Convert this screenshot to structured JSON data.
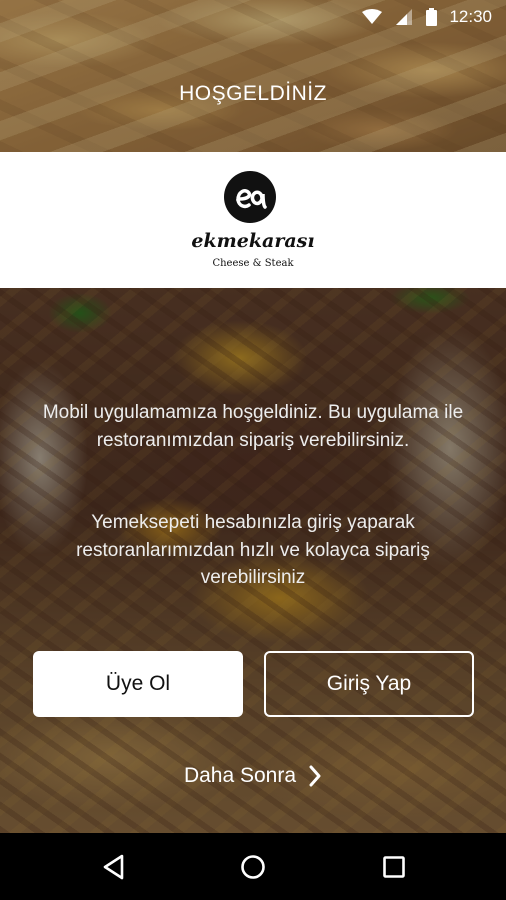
{
  "status_bar": {
    "time": "12:30",
    "icons": [
      "wifi-icon",
      "signal-icon",
      "battery-icon"
    ]
  },
  "header": {
    "title": "HOŞGELDİNİZ"
  },
  "brand": {
    "logo_icon": "ekmekarasi-logo-icon",
    "name": "ekmekarası",
    "tagline": "Cheese & Steak"
  },
  "message": {
    "paragraph_1": "Mobil uygulamamıza hoşgeldiniz. Bu uygulama ile restoranımızdan sipariş verebilirsiniz.",
    "paragraph_2": "Yemeksepeti hesabınızla giriş yaparak restoranlarımızdan hızlı ve kolayca sipariş verebilirsiniz"
  },
  "actions": {
    "register_label": "Üye Ol",
    "login_label": "Giriş Yap",
    "later_label": "Daha Sonra",
    "later_icon": "chevron-right-icon"
  },
  "nav_bar": {
    "buttons": [
      "back-icon",
      "home-icon",
      "recents-icon"
    ]
  },
  "colors": {
    "text_light": "#ffffff",
    "button_fill": "#ffffff",
    "nav_bar": "#000000"
  }
}
